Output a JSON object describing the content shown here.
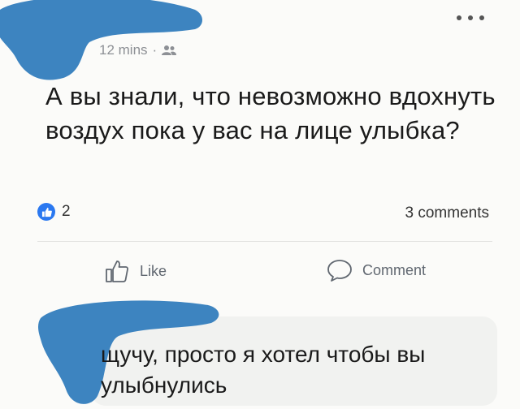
{
  "post": {
    "timestamp": "12 mins",
    "separator": "·",
    "audience_icon": "friends-icon",
    "more_icon": "more-horizontal-icon",
    "text": "А вы знали, что невозможно вдохнуть воздух пока у вас на лице улыбка?"
  },
  "stats": {
    "likes": "2",
    "comments": "3 comments",
    "like_badge_color": "#2a78f0"
  },
  "actions": {
    "like": "Like",
    "comment": "Comment"
  },
  "comment": {
    "text": "щучу, просто я хотел чтобы вы улыбнулись"
  },
  "colors": {
    "redaction_blob": "#3d84c0"
  }
}
